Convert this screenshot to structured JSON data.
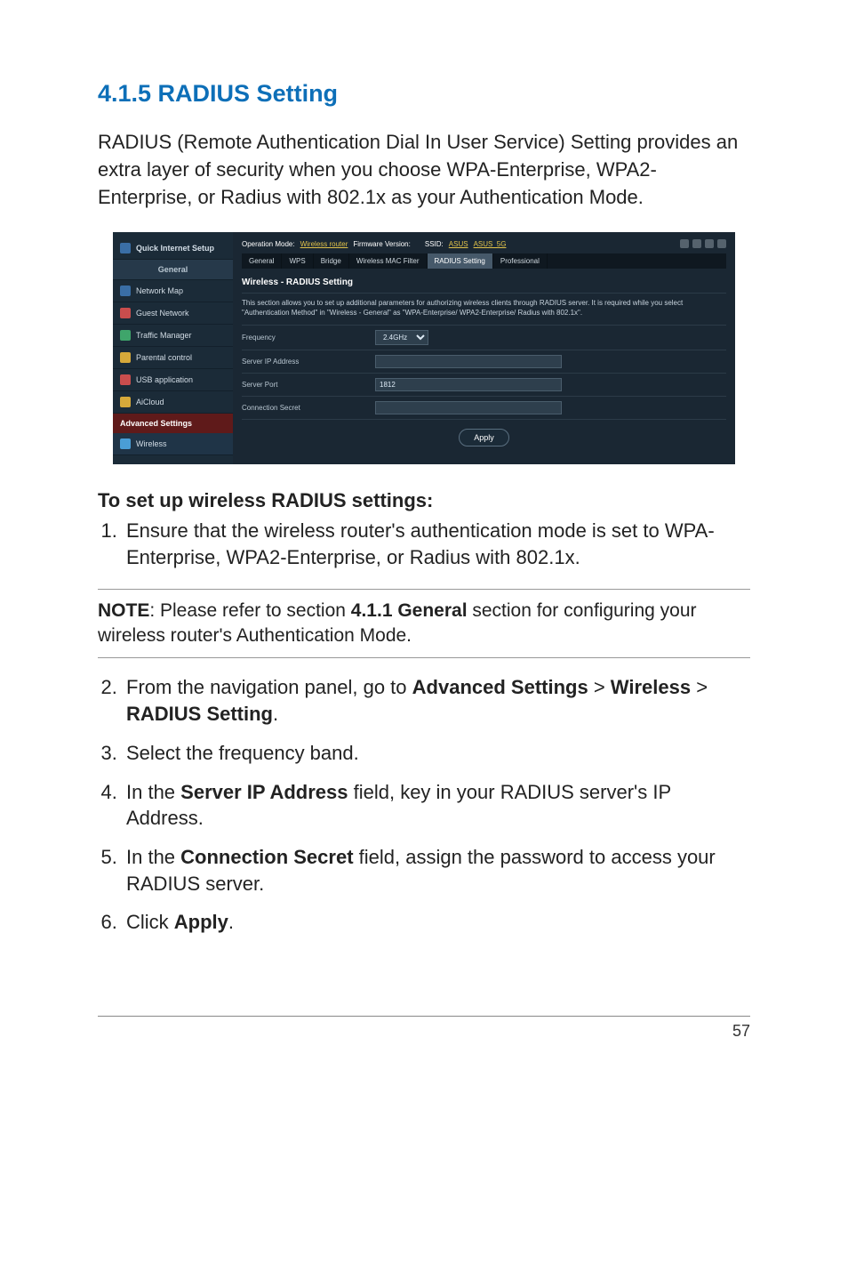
{
  "heading": "4.1.5 RADIUS Setting",
  "intro": "RADIUS (Remote Authentication Dial In User Service) Setting provides an extra layer of security when you choose WPA-Enterprise, WPA2-Enterprise, or Radius with 802.1x as your Authentication Mode.",
  "screenshot": {
    "sidebar": {
      "qis": "Quick Internet Setup",
      "header_general": "General",
      "items": [
        "Network Map",
        "Guest Network",
        "Traffic Manager",
        "Parental control",
        "USB application",
        "AiCloud"
      ],
      "header_advanced": "Advanced Settings",
      "sub_wireless": "Wireless"
    },
    "topbar": {
      "opmode_label": "Operation Mode:",
      "opmode_value": "Wireless router",
      "fw_label": "Firmware Version:",
      "ssid_label": "SSID:",
      "ssid1": "ASUS",
      "ssid2": "ASUS_5G"
    },
    "tabs": [
      "General",
      "WPS",
      "Bridge",
      "Wireless MAC Filter",
      "RADIUS Setting",
      "Professional"
    ],
    "active_tab_index": 4,
    "panel_title": "Wireless - RADIUS Setting",
    "panel_desc": "This section allows you to set up additional parameters for authorizing wireless clients through RADIUS server. It is required while you select \"Authentication Method\" in \"Wireless - General\" as \"WPA-Enterprise/ WPA2-Enterprise/ Radius with 802.1x\".",
    "form": {
      "frequency_label": "Frequency",
      "frequency_value": "2.4GHz",
      "server_ip_label": "Server IP Address",
      "server_ip_value": "",
      "server_port_label": "Server Port",
      "server_port_value": "1812",
      "conn_secret_label": "Connection Secret",
      "conn_secret_value": ""
    },
    "apply_label": "Apply"
  },
  "steps_title": "To set up wireless RADIUS settings:",
  "step1": "Ensure that the wireless router's authentication mode is set to WPA-Enterprise, WPA2-Enterprise, or Radius with 802.1x.",
  "note": {
    "label": "NOTE",
    "pre": ":  Please refer to section ",
    "bold": "4.1.1 General",
    "post": " section for configuring your wireless router's Authentication Mode."
  },
  "step2": {
    "pre": "From the navigation panel, go to ",
    "b1": "Advanced Settings",
    "mid1": " > ",
    "b2": "Wireless",
    "mid2": " > ",
    "b3": "RADIUS Setting",
    "post": "."
  },
  "step3": "Select the frequency band.",
  "step4": {
    "pre": "In the ",
    "b": "Server IP Address",
    "post": " field, key in your RADIUS server's IP Address."
  },
  "step5": {
    "pre": "In the ",
    "b": "Connection Secret",
    "post": " field, assign the password to access your RADIUS server."
  },
  "step6": {
    "pre": "Click ",
    "b": "Apply",
    "post": "."
  },
  "page_number": "57"
}
